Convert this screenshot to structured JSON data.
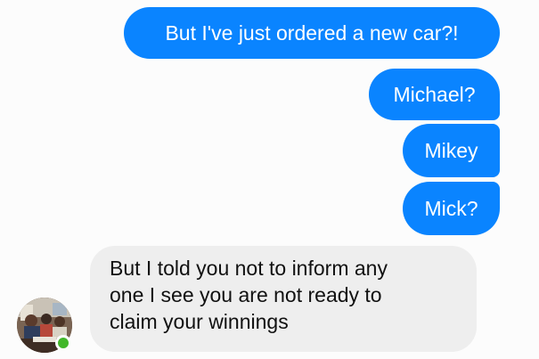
{
  "conversation": {
    "outgoing": [
      {
        "text": "But I've just ordered a new car?!"
      },
      {
        "text": "Michael?"
      },
      {
        "text": "Mikey"
      },
      {
        "text": "Mick?"
      }
    ],
    "incoming": {
      "lines": [
        "But I told you not to inform any",
        "one I see you are not ready to",
        "claim your winnings"
      ]
    },
    "contact": {
      "online": true
    }
  },
  "colors": {
    "outgoing_bubble": "#0a84ff",
    "incoming_bubble": "#eeeeee",
    "online_indicator": "#42b72a",
    "background": "#fcfcfc"
  }
}
